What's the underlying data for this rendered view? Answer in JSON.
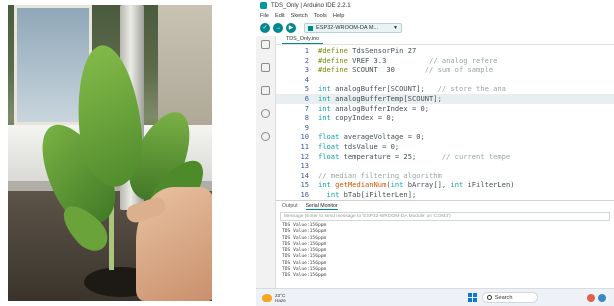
{
  "ide": {
    "window_title": "TDS_Only | Arduino IDE 2.2.1",
    "menu": [
      "File",
      "Edit",
      "Sketch",
      "Tools",
      "Help"
    ],
    "toolbar": {
      "verify_icon": "check-icon",
      "upload_icon": "arrow-right-icon",
      "debug_icon": "debug-icon",
      "board": "ESP32-WROOM-DA M..."
    },
    "sidebar_icons": [
      "folder-icon",
      "board-manager-icon",
      "library-icon",
      "debug-icon",
      "search-icon"
    ],
    "file_tab": "TDS_Only.ino",
    "code_lines": [
      {
        "n": "1",
        "t": "#define TdsSensorPin 27"
      },
      {
        "n": "2",
        "t": "#define VREF 3.3          // analog refere"
      },
      {
        "n": "3",
        "t": "#define SCOUNT  30       // sum of sample"
      },
      {
        "n": "4",
        "t": ""
      },
      {
        "n": "5",
        "t": "int analogBuffer[SCOUNT];   // store the ana"
      },
      {
        "n": "6",
        "t": "int analogBufferTemp[SCOUNT];"
      },
      {
        "n": "7",
        "t": "int analogBufferIndex = 0;"
      },
      {
        "n": "8",
        "t": "int copyIndex = 0;"
      },
      {
        "n": "9",
        "t": ""
      },
      {
        "n": "10",
        "t": "float averageVoltage = 0;"
      },
      {
        "n": "11",
        "t": "float tdsValue = 0;"
      },
      {
        "n": "12",
        "t": "float temperature = 25;      // current tempe"
      },
      {
        "n": "13",
        "t": ""
      },
      {
        "n": "14",
        "t": "// median filtering algorithm"
      },
      {
        "n": "15",
        "t": "int getMedianNum(int bArray[], int iFilterLen)"
      },
      {
        "n": "16",
        "t": "  int bTab[iFilterLen];"
      }
    ],
    "serial": {
      "tabs": [
        "Output",
        "Serial Monitor"
      ],
      "active_tab": "Serial Monitor",
      "input_placeholder": "Message (Enter to send message to 'ESP32-WROOM-DA Module' on 'COM3')",
      "output_lines": [
        "TDS Value:156ppm",
        "TDS Value:156ppm",
        "TDS Value:156ppm",
        "TDS Value:156ppm",
        "TDS Value:156ppm",
        "TDS Value:156ppm",
        "TDS Value:156ppm",
        "TDS Value:156ppm",
        "TDS Value:156ppm"
      ]
    },
    "taskbar": {
      "temperature": "23°C",
      "weather": "Haze",
      "search": "Search"
    }
  }
}
